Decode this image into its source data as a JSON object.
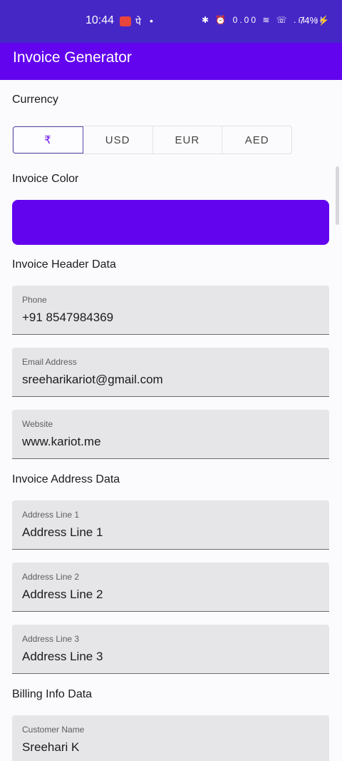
{
  "status_bar": {
    "time": "10:44",
    "cast_icon": "screen-record-icon",
    "glyph": "पे",
    "dot": "•",
    "icons_text": "✱ ⏰ 0.00 ≋ ☏ .ıl .ıl",
    "battery": "74%⚡"
  },
  "app_bar": {
    "title": "Invoice Generator"
  },
  "currency": {
    "label": "Currency",
    "options": [
      "₹",
      "USD",
      "EUR",
      "AED"
    ],
    "selected": "₹"
  },
  "invoice_color": {
    "label": "Invoice Color",
    "value": "#6205ee"
  },
  "header_data": {
    "label": "Invoice Header Data",
    "fields": [
      {
        "label": "Phone",
        "value": "+91 8547984369"
      },
      {
        "label": "Email Address",
        "value": "sreeharikariot@gmail.com"
      },
      {
        "label": "Website",
        "value": "www.kariot.me"
      }
    ]
  },
  "address_data": {
    "label": "Invoice Address Data",
    "fields": [
      {
        "label": "Address Line 1",
        "value": "Address Line 1"
      },
      {
        "label": "Address Line 2",
        "value": "Address Line 2"
      },
      {
        "label": "Address Line 3",
        "value": "Address Line 3"
      }
    ]
  },
  "billing_data": {
    "label": "Billing Info Data",
    "fields": [
      {
        "label": "Customer Name",
        "value": "Sreehari K"
      }
    ]
  }
}
